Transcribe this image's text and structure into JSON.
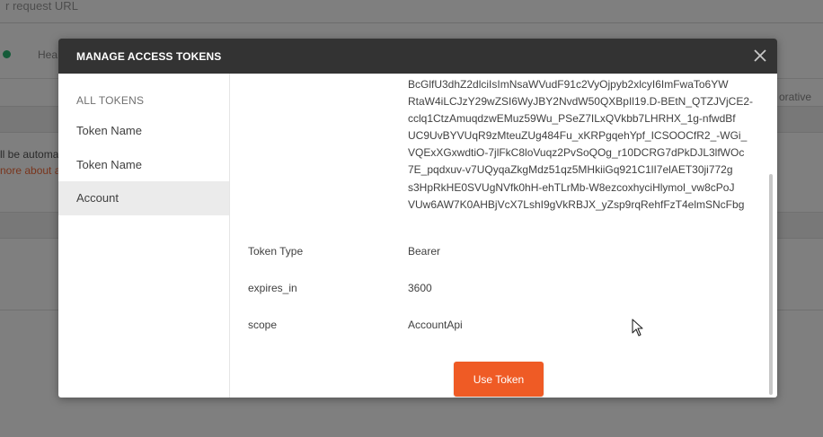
{
  "background": {
    "url_placeholder": "r request URL",
    "tab_header": "Hea",
    "collab_fragment": "orative en",
    "auto_fragment": "ll be automa",
    "more_fragment": "nore about a"
  },
  "modal": {
    "title": "MANAGE ACCESS TOKENS",
    "close_icon": "close-icon"
  },
  "sidebar": {
    "heading": "ALL TOKENS",
    "items": [
      {
        "label": "Token Name",
        "active": false
      },
      {
        "label": "Token Name",
        "active": false
      },
      {
        "label": "Account",
        "active": true
      }
    ]
  },
  "token": {
    "access_token_lines": [
      "BcGlfU3dhZ2dlciIsImNsaWVudF91c2VyOjpyb2xlcyI6ImFwaTo6YW",
      "RtaW4iLCJzY29wZSI6WyJBY2NvdW50QXBpIl19.D-BEtN_QTZJVjCE2-",
      "cclq1CtzAmuqdzwEMuz59Wu_PSeZ7ILxQVkbb7LHRHX_1g-nfwdBf",
      "UC9UvBYVUqR9zMteuZUg484Fu_xKRPgqehYpf_ICSOOCfR2_-WGi_",
      "VQExXGxwdtiO-7jlFkC8loVuqz2PvSoQOg_r10DCRG7dPkDJL3lfWOc",
      "7E_pqdxuv-v7UQyqaZkgMdz51qz5MHkiiGq921C1lI7elAET30ji772g",
      "s3HpRkHE0SVUgNVfk0hH-ehTLrMb-W8ezcoxhyciHlymol_vw8cPoJ",
      "VUw6AW7K0AHBjVcX7LshI9gVkRBJX_yZsp9rqRehfFzT4elmSNcFbg"
    ],
    "rows": [
      {
        "label": "Token Type",
        "value": "Bearer"
      },
      {
        "label": "expires_in",
        "value": "3600"
      },
      {
        "label": "scope",
        "value": "AccountApi"
      }
    ],
    "use_button": "Use Token"
  },
  "colors": {
    "header_bg": "#333333",
    "accent": "#ef5b25",
    "active_item_bg": "#ebebeb"
  }
}
